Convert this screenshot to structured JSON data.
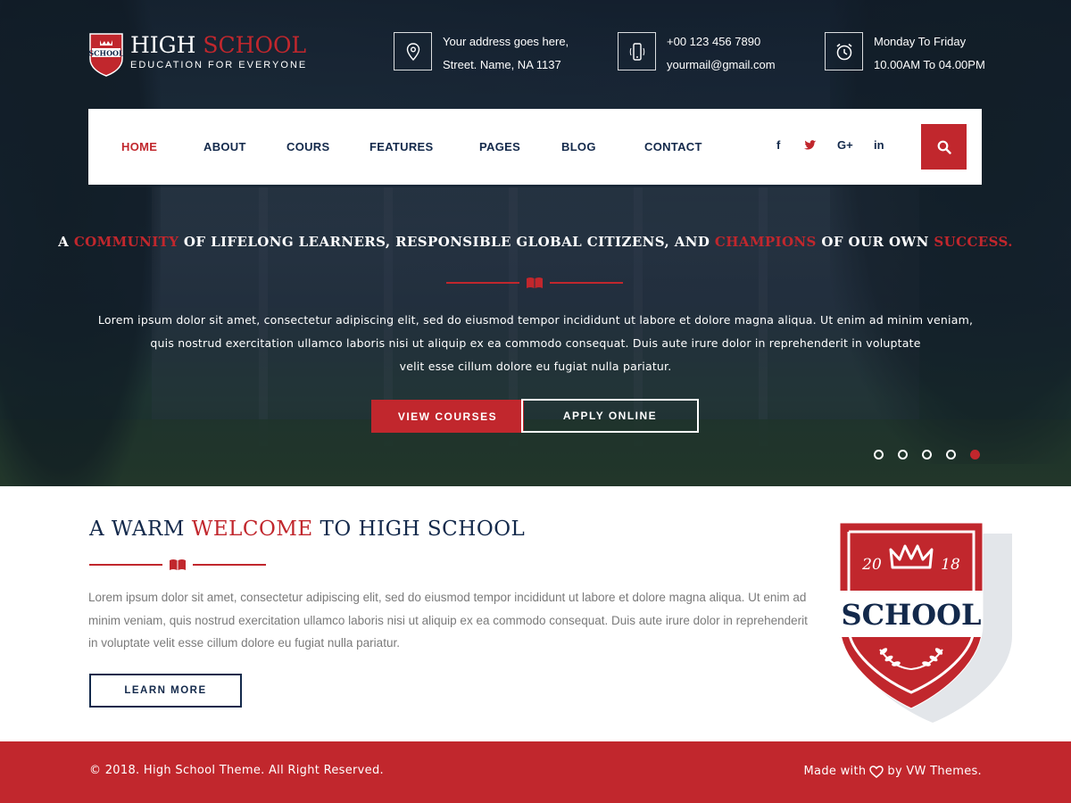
{
  "brand": {
    "title_main": "HIGH",
    "title_accent": "SCHOOL",
    "tagline": "EDUCATION FOR EVERYONE",
    "shield_text": "SCHOOL"
  },
  "contact": {
    "address_line1": "Your address goes here,",
    "address_line2": "Street. Name, NA 1137",
    "phone": "+00 123 456 7890",
    "email": "yourmail@gmail.com",
    "hours_days": "Monday To Friday",
    "hours_time": "10.00AM To 04.00PM"
  },
  "nav": {
    "items": [
      {
        "label": "HOME",
        "active": true
      },
      {
        "label": "ABOUT",
        "active": false
      },
      {
        "label": "COURS",
        "active": false
      },
      {
        "label": "FEATURES",
        "active": false
      },
      {
        "label": "PAGES",
        "active": false
      },
      {
        "label": "BLOG",
        "active": false
      },
      {
        "label": "CONTACT",
        "active": false
      }
    ],
    "social": {
      "facebook": "f",
      "twitter": "twitter",
      "google": "G+",
      "linkedin": "in"
    }
  },
  "hero": {
    "headline": {
      "p1": "A ",
      "r1": "COMMUNITY",
      "p2": " OF LIFELONG LEARNERS, RESPONSIBLE GLOBAL CITIZENS, AND ",
      "r2": "CHAMPIONS",
      "p3": " OF OUR OWN ",
      "r3": "SUCCESS."
    },
    "text_line1": "Lorem ipsum dolor sit amet, consectetur adipiscing elit, sed do eiusmod tempor incididunt ut labore et dolore magna aliqua. Ut enim ad minim veniam,",
    "text_line2": "quis nostrud exercitation ullamco laboris nisi ut aliquip ex ea commodo consequat. Duis aute irure dolor in reprehenderit in voluptate",
    "text_line3": "velit esse cillum dolore eu fugiat nulla pariatur.",
    "btn_primary": "VIEW COURSES",
    "btn_secondary": "APPLY ONLINE",
    "slide_count": 5,
    "active_slide": 5
  },
  "welcome": {
    "title_p1": "A WARM ",
    "title_red": "WELCOME",
    "title_p2": " TO HIGH SCHOOL",
    "text": "Lorem ipsum dolor sit amet, consectetur adipiscing elit, sed do eiusmod tempor incididunt ut labore et dolore magna aliqua. Ut enim ad minim veniam, quis nostrud exercitation ullamco laboris nisi ut aliquip ex ea commodo consequat. Duis aute irure dolor in reprehenderit in voluptate velit esse cillum dolore eu fugiat nulla pariatur.",
    "button": "LEARN MORE",
    "badge": {
      "year_left": "20",
      "year_right": "18",
      "word": "SCHOOL"
    }
  },
  "footer": {
    "copyright": "© 2018. High School Theme. All Right Reserved.",
    "made_prefix": "Made with",
    "made_suffix": "by VW Themes."
  },
  "colors": {
    "accent": "#c1272d",
    "navy": "#13294b",
    "text_gray": "#7a7a7a"
  },
  "icons": {
    "address": "map-pin-icon",
    "phone": "mobile-phone-icon",
    "hours": "alarm-clock-icon",
    "search": "search-icon",
    "divider": "open-book-icon",
    "heart": "heart-icon"
  }
}
